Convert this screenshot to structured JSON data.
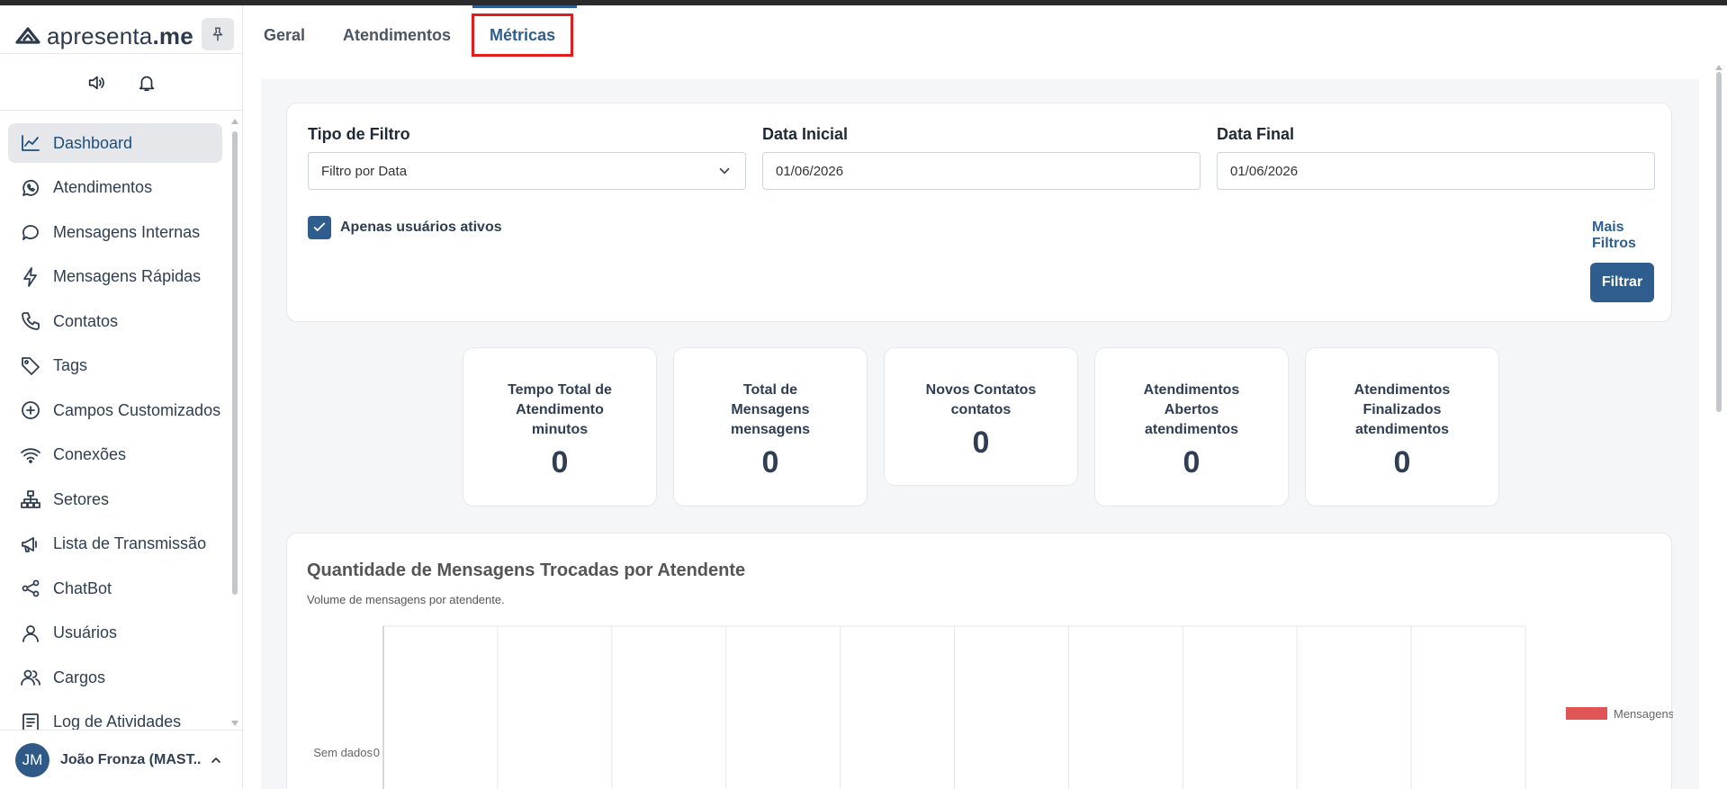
{
  "brand": {
    "name_light": "apresenta",
    "name_bold": ".me"
  },
  "sidebar": {
    "items": [
      {
        "label": "Dashboard",
        "icon": "chart-line-icon",
        "active": true
      },
      {
        "label": "Atendimentos",
        "icon": "whatsapp-icon"
      },
      {
        "label": "Mensagens Internas",
        "icon": "chat-bubble-icon"
      },
      {
        "label": "Mensagens Rápidas",
        "icon": "lightning-icon"
      },
      {
        "label": "Contatos",
        "icon": "phone-icon"
      },
      {
        "label": "Tags",
        "icon": "tag-icon"
      },
      {
        "label": "Campos Customizados",
        "icon": "plus-circle-icon"
      },
      {
        "label": "Conexões",
        "icon": "wifi-icon"
      },
      {
        "label": "Setores",
        "icon": "org-chart-icon"
      },
      {
        "label": "Lista de Transmissão",
        "icon": "megaphone-icon"
      },
      {
        "label": "ChatBot",
        "icon": "share-nodes-icon"
      },
      {
        "label": "Usuários",
        "icon": "user-icon"
      },
      {
        "label": "Cargos",
        "icon": "users-icon"
      },
      {
        "label": "Log de Atividades",
        "icon": "log-icon"
      }
    ],
    "user": {
      "initials": "JM",
      "name": "João Fronza (MAST..."
    }
  },
  "tabs": [
    {
      "label": "Geral"
    },
    {
      "label": "Atendimentos"
    },
    {
      "label": "Métricas",
      "active": true
    }
  ],
  "filters": {
    "type_label": "Tipo de Filtro",
    "type_value": "Filtro por Data",
    "start_label": "Data Inicial",
    "start_value": "01/06/2026",
    "end_label": "Data Final",
    "end_value": "01/06/2026",
    "active_only_label": "Apenas usuários ativos",
    "active_only_checked": true,
    "more_label": "Mais Filtros",
    "filter_button": "Filtrar"
  },
  "stats": [
    {
      "lines": [
        "Tempo Total de",
        "Atendimento",
        "minutos"
      ],
      "value": "0"
    },
    {
      "lines": [
        "Total de",
        "Mensagens",
        "mensagens"
      ],
      "value": "0"
    },
    {
      "lines": [
        "Novos Contatos",
        "contatos"
      ],
      "value": "0"
    },
    {
      "lines": [
        "Atendimentos",
        "Abertos",
        "atendimentos"
      ],
      "value": "0"
    },
    {
      "lines": [
        "Atendimentos",
        "Finalizados",
        "atendimentos"
      ],
      "value": "0"
    }
  ],
  "chart_data": {
    "type": "bar",
    "title": "Quantidade de Mensagens Trocadas por Atendente",
    "subtitle": "Volume de mensagens por atendente.",
    "categories": [
      "Sem dados"
    ],
    "series": [
      {
        "name": "Mensagens",
        "values": [
          0
        ],
        "color": "#e05555"
      }
    ],
    "xlim": [
      0,
      10
    ],
    "x_ticks": [
      "0"
    ],
    "grid": true,
    "legend": "right",
    "orientation": "horizontal"
  },
  "colors": {
    "primary": "#2f5e8e",
    "active_tab_outline": "#e11d1d",
    "bar": "#e05555"
  }
}
